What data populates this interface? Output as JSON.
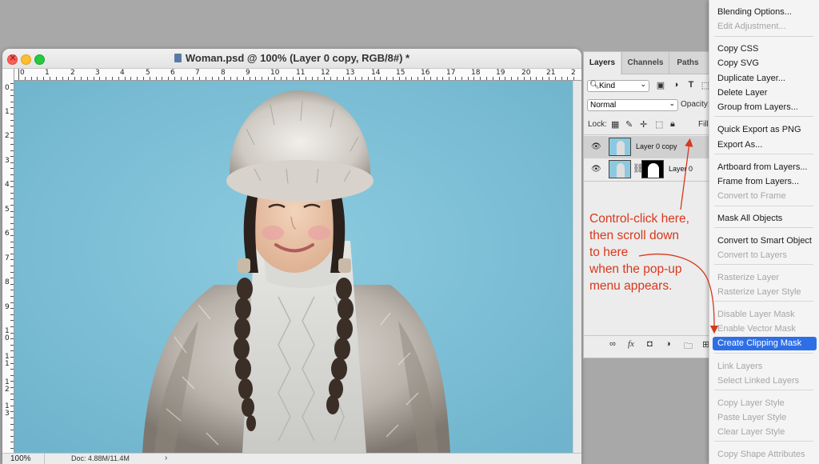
{
  "document": {
    "title": "Woman.psd @ 100% (Layer 0 copy, RGB/8#) *",
    "ruler_h": [
      "0",
      "1",
      "2",
      "3",
      "4",
      "5",
      "6",
      "7",
      "8",
      "9",
      "10",
      "11",
      "12",
      "13",
      "14",
      "15",
      "16",
      "17",
      "18",
      "19",
      "20",
      "21",
      "2"
    ],
    "ruler_v": [
      "0",
      "1",
      "2",
      "3",
      "4",
      "5",
      "6",
      "7",
      "8",
      "9",
      "1\n0",
      "1\n1",
      "1\n2",
      "1\n3"
    ],
    "zoom": "100%",
    "doc_size": "Doc: 4.88M/11.4M",
    "status_arrow": "›"
  },
  "layers_panel": {
    "tabs": [
      "Layers",
      "Channels",
      "Paths"
    ],
    "kind_label": "Kind",
    "blend_mode": "Normal",
    "opacity_label": "Opacity:",
    "lock_label": "Lock:",
    "fill_label": "Fill:",
    "layers": [
      {
        "name": "Layer 0 copy",
        "selected": true
      },
      {
        "name": "Layer 0",
        "selected": false
      }
    ]
  },
  "annotation": {
    "lines": [
      "Control-click here,",
      "then scroll down",
      "to here",
      "when the pop-up",
      "menu appears."
    ],
    "color": "#d8381c"
  },
  "context_menu": {
    "items": [
      {
        "label": "Blending Options...",
        "enabled": true
      },
      {
        "label": "Edit Adjustment...",
        "enabled": false
      },
      {
        "label": "Copy CSS",
        "enabled": true
      },
      {
        "label": "Copy SVG",
        "enabled": true
      },
      {
        "label": "Duplicate Layer...",
        "enabled": true
      },
      {
        "label": "Delete Layer",
        "enabled": true
      },
      {
        "label": "Group from Layers...",
        "enabled": true
      },
      {
        "label": "Quick Export as PNG",
        "enabled": true
      },
      {
        "label": "Export As...",
        "enabled": true
      },
      {
        "label": "Artboard from Layers...",
        "enabled": true
      },
      {
        "label": "Frame from Layers...",
        "enabled": true
      },
      {
        "label": "Convert to Frame",
        "enabled": false
      },
      {
        "label": "Mask All Objects",
        "enabled": true
      },
      {
        "label": "Convert to Smart Object",
        "enabled": true
      },
      {
        "label": "Convert to Layers",
        "enabled": false
      },
      {
        "label": "Rasterize Layer",
        "enabled": false
      },
      {
        "label": "Rasterize Layer Style",
        "enabled": false
      },
      {
        "label": "Disable Layer Mask",
        "enabled": false
      },
      {
        "label": "Enable Vector Mask",
        "enabled": false
      },
      {
        "label": "Create Clipping Mask",
        "enabled": true,
        "highlighted": true
      },
      {
        "label": "Link Layers",
        "enabled": false
      },
      {
        "label": "Select Linked Layers",
        "enabled": false
      },
      {
        "label": "Copy Layer Style",
        "enabled": false
      },
      {
        "label": "Paste Layer Style",
        "enabled": false
      },
      {
        "label": "Clear Layer Style",
        "enabled": false
      },
      {
        "label": "Copy Shape Attributes",
        "enabled": false
      }
    ],
    "highlight_color": "#2f6fe6"
  },
  "colors": {
    "canvas_background": "#7fc1d8",
    "workspace": "#a8a8a8"
  }
}
